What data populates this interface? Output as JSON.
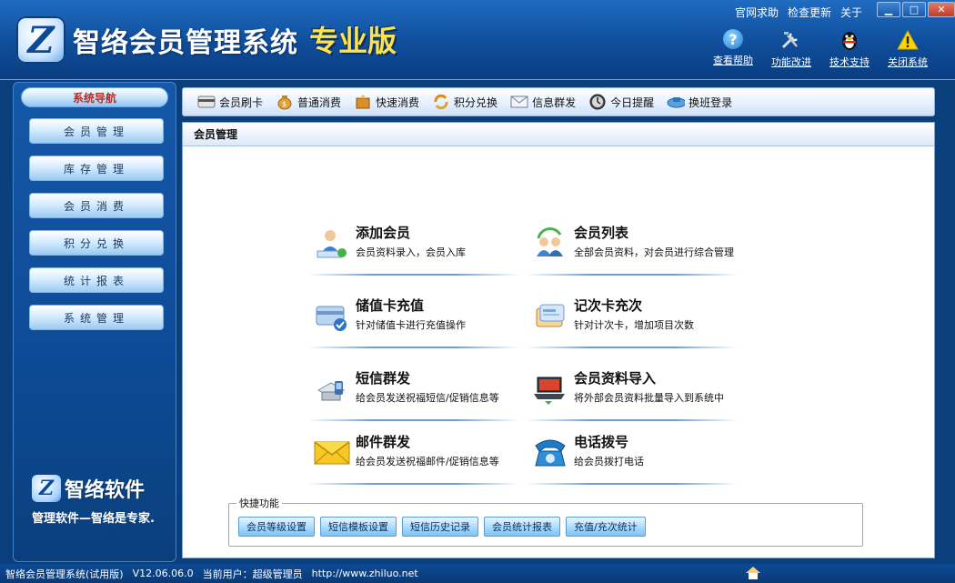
{
  "app": {
    "logo_glyph": "Z",
    "title": "智络会员管理系统",
    "edition": "专业版"
  },
  "top_links": [
    "官网求助",
    "检查更新",
    "关于"
  ],
  "window_buttons": {
    "minimize": "▁",
    "maximize": "□",
    "close": "✕"
  },
  "tool_buttons": [
    {
      "label": "查看帮助",
      "icon": "help-icon"
    },
    {
      "label": "功能改进",
      "icon": "tools-icon"
    },
    {
      "label": "技术支持",
      "icon": "qq-penguin-icon"
    },
    {
      "label": "关闭系统",
      "icon": "warning-icon"
    }
  ],
  "sidebar": {
    "header": "系统导航",
    "items": [
      {
        "label": "会员管理"
      },
      {
        "label": "库存管理"
      },
      {
        "label": "会员消费"
      },
      {
        "label": "积分兑换"
      },
      {
        "label": "统计报表"
      },
      {
        "label": "系统管理"
      }
    ],
    "brand_glyph": "Z",
    "brand_name": "智络软件",
    "brand_slogan": "管理软件—智络是专家."
  },
  "toolbar": [
    {
      "label": "会员刷卡",
      "icon": "card-swipe-icon"
    },
    {
      "label": "普通消费",
      "icon": "money-bag-icon"
    },
    {
      "label": "快速消费",
      "icon": "fast-consume-icon"
    },
    {
      "label": "积分兑换",
      "icon": "exchange-icon"
    },
    {
      "label": "信息群发",
      "icon": "mail-icon"
    },
    {
      "label": "今日提醒",
      "icon": "clock-icon"
    },
    {
      "label": "换班登录",
      "icon": "shift-login-icon"
    }
  ],
  "panel": {
    "title": "会员管理",
    "functions": [
      {
        "title": "添加会员",
        "desc": "会员资料录入，会员入库",
        "icon": "add-member-icon"
      },
      {
        "title": "会员列表",
        "desc": "全部会员资料，对会员进行综合管理",
        "icon": "member-list-icon"
      },
      {
        "title": "储值卡充值",
        "desc": "针对储值卡进行充值操作",
        "icon": "stored-card-icon"
      },
      {
        "title": "记次卡充次",
        "desc": "针对计次卡，增加项目次数",
        "icon": "count-card-icon"
      },
      {
        "title": "短信群发",
        "desc": "给会员发送祝福短信/促销信息等",
        "icon": "sms-icon"
      },
      {
        "title": "会员资料导入",
        "desc": "将外部会员资料批量导入到系统中",
        "icon": "import-icon"
      },
      {
        "title": "邮件群发",
        "desc": "给会员发送祝福邮件/促销信息等",
        "icon": "envelope-icon"
      },
      {
        "title": "电话拨号",
        "desc": "给会员拨打电话",
        "icon": "telephone-icon"
      }
    ],
    "quick": {
      "label": "快捷功能",
      "buttons": [
        "会员等级设置",
        "短信模板设置",
        "短信历史记录",
        "会员统计报表",
        "充值/充次统计"
      ]
    }
  },
  "status": {
    "app_name": "智络会员管理系统(试用版)",
    "version": "V12.06.06.0",
    "user": "当前用户：超级管理员",
    "url": "http://www.zhiluo.net"
  },
  "colors": {
    "frame": "#0a3f7c",
    "edition_yellow": "#ffe34d",
    "nav_header_text": "#b0302a"
  }
}
